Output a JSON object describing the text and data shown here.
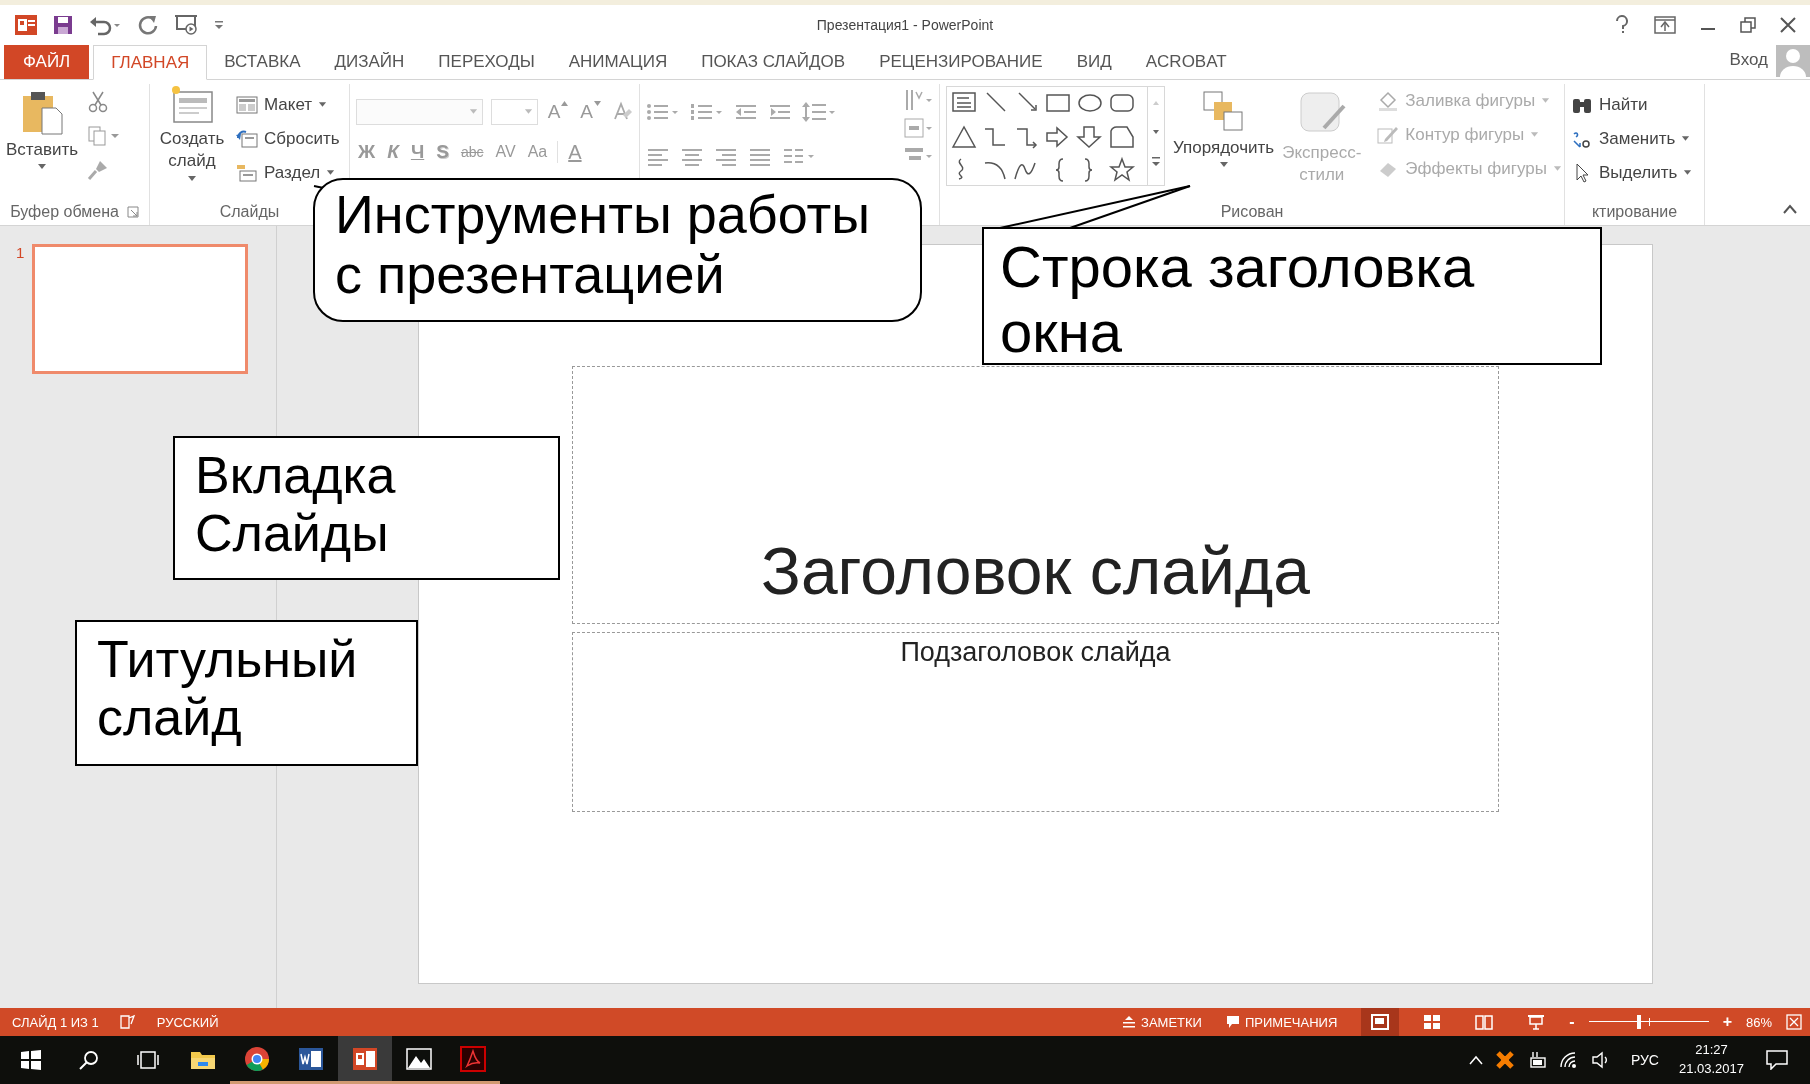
{
  "window": {
    "title": "Презентация1 - PowerPoint"
  },
  "tabs": [
    {
      "label": "ФАЙЛ",
      "kind": "file",
      "selected": false
    },
    {
      "label": "ГЛАВНАЯ",
      "kind": "tab",
      "selected": true
    },
    {
      "label": "ВСТАВКА",
      "kind": "tab",
      "selected": false
    },
    {
      "label": "ДИЗАЙН",
      "kind": "tab",
      "selected": false
    },
    {
      "label": "ПЕРЕХОДЫ",
      "kind": "tab",
      "selected": false
    },
    {
      "label": "АНИМАЦИЯ",
      "kind": "tab",
      "selected": false
    },
    {
      "label": "ПОКАЗ СЛАЙДОВ",
      "kind": "tab",
      "selected": false
    },
    {
      "label": "РЕЦЕНЗИРОВАНИЕ",
      "kind": "tab",
      "selected": false
    },
    {
      "label": "ВИД",
      "kind": "tab",
      "selected": false
    },
    {
      "label": "ACROBAT",
      "kind": "tab",
      "selected": false
    }
  ],
  "account": {
    "label": "Вход"
  },
  "ribbon": {
    "clipboard": {
      "paste": "Вставить",
      "label": "Буфер обмена"
    },
    "slides": {
      "new_slide": "Создать слайд",
      "layout": "Макет",
      "reset": "Сбросить",
      "section": "Раздел",
      "label": "Слайды"
    },
    "font": {
      "disabled": true,
      "grow": "A",
      "shrink": "A",
      "formats": [
        "Ж",
        "К",
        "Ч",
        "S",
        "abc",
        "AV",
        "Aa"
      ],
      "text_color_glyph": "A"
    },
    "drawing": {
      "arrange": "Упорядочить",
      "quick_styles": {
        "label": "Экспресс-стили",
        "disabled": true
      },
      "format_items": [
        {
          "label": "Заливка фигуры",
          "disabled": true
        },
        {
          "label": "Контур фигуры",
          "disabled": true
        },
        {
          "label": "Эффекты фигуры",
          "disabled": true
        }
      ],
      "label": "Рисован"
    },
    "editing": {
      "find": "Найти",
      "replace": "Заменить",
      "select": "Выделить",
      "label": "ктирование"
    }
  },
  "slide_panel": {
    "slides": [
      {
        "number": "1",
        "selected": true
      }
    ]
  },
  "slide": {
    "title": "Заголовок слайда",
    "subtitle": "Подзаголовок слайда"
  },
  "callouts": [
    {
      "text": "Инструменты работы с презентацией",
      "kind": "rounded"
    },
    {
      "text": "Строка заголовка окна",
      "kind": "rect"
    },
    {
      "text": "Вкладка Слайды",
      "kind": "rect"
    },
    {
      "text": "Титульный слайд",
      "kind": "rect"
    }
  ],
  "status_bar": {
    "slide": "СЛАЙД 1 ИЗ 1",
    "language": "РУССКИЙ",
    "notes": "ЗАМЕТКИ",
    "comments": "ПРИМЕЧАНИЯ",
    "views": [
      {
        "kind": "normal",
        "selected": true
      },
      {
        "kind": "sorter",
        "selected": false
      },
      {
        "kind": "reading",
        "selected": false
      },
      {
        "kind": "slideshow",
        "selected": false
      }
    ],
    "zoom_out": "-",
    "zoom_in": "+",
    "zoom": {
      "level": 0.42
    },
    "zoom_value": "86%"
  },
  "taskbar": {
    "apps": [
      {
        "kind": "explorer",
        "running": false,
        "selected": false
      },
      {
        "kind": "chrome",
        "running": true,
        "selected": false
      },
      {
        "kind": "word",
        "running": true,
        "selected": false
      },
      {
        "kind": "powerpoint",
        "running": true,
        "selected": true
      },
      {
        "kind": "photos",
        "running": true,
        "selected": false
      },
      {
        "kind": "acrobat",
        "running": true,
        "selected": false
      }
    ],
    "language": "РУС",
    "time": "21:27",
    "date": "21.03.2017"
  }
}
